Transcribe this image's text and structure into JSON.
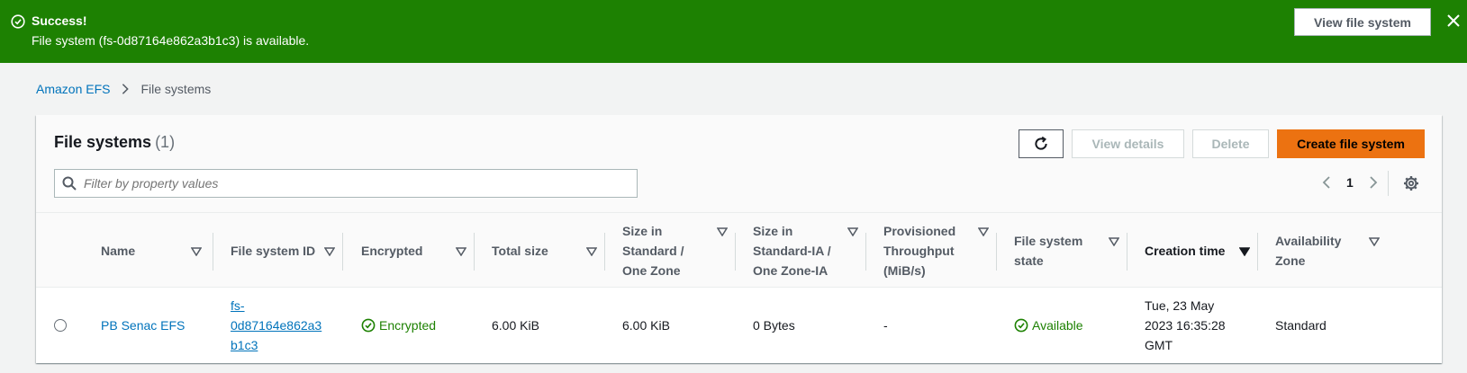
{
  "flash": {
    "title": "Success!",
    "message": "File system (fs-0d87164e862a3b1c3) is available.",
    "button": "View file system",
    "color": "#1d8102"
  },
  "breadcrumb": {
    "root": "Amazon EFS",
    "current": "File systems"
  },
  "panel": {
    "title": "File systems",
    "count": "(1)",
    "buttons": {
      "view_details": "View details",
      "delete": "Delete",
      "create": "Create file system"
    },
    "filter_placeholder": "Filter by property values",
    "page": "1"
  },
  "table": {
    "columns": {
      "name": "Name",
      "fsid": "File system ID",
      "encrypted": "Encrypted",
      "total_size": "Total size",
      "size_std_1": "Size in",
      "size_std_2": "Standard /",
      "size_std_3": "One Zone",
      "size_ia_1": "Size in",
      "size_ia_2": "Standard-IA /",
      "size_ia_3": "One Zone-IA",
      "prov_1": "Provisioned",
      "prov_2": "Throughput",
      "prov_3": "(MiB/s)",
      "state_1": "File system",
      "state_2": "state",
      "creation": "Creation time",
      "az_1": "Availability",
      "az_2": "Zone"
    },
    "rows": [
      {
        "name": "PB Senac EFS",
        "fsid_1": "fs-",
        "fsid_2": "0d87164e862a3",
        "fsid_3": "b1c3",
        "encrypted": "Encrypted",
        "total_size": "6.00 KiB",
        "size_std": "6.00 KiB",
        "size_ia": "0 Bytes",
        "throughput": "-",
        "state": "Available",
        "created_1": "Tue, 23 May",
        "created_2": "2023 16:35:28",
        "created_3": "GMT",
        "az": "Standard"
      }
    ]
  },
  "colors": {
    "accent": "#ec7211",
    "link": "#0073bb",
    "success": "#1d8102"
  }
}
